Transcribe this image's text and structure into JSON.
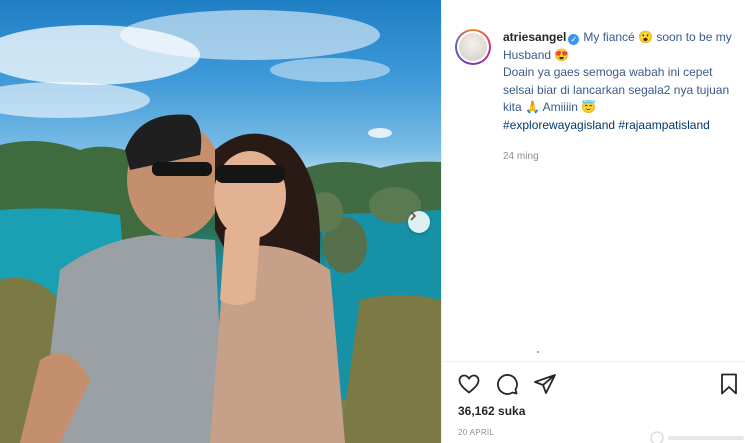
{
  "post": {
    "username": "atriesangel",
    "verified_icon": "verified-badge-icon",
    "caption_line1": "My fiancé 😮 soon to be my Husband 😍",
    "caption_line2": "Doain ya gaes semoga wabah ini cepet selsai biar di lancarkan segala2 nya tujuan kita 🙏 Amiiiin 😇",
    "hashtags": [
      "#explorewayagisland",
      "#rajaampatisland"
    ],
    "time_ago": "24 ming",
    "likes": "36,162 suka",
    "date": "20 APRIL"
  },
  "actions": {
    "like_icon": "heart-icon",
    "comment_icon": "comment-icon",
    "share_icon": "share-icon",
    "save_icon": "bookmark-icon"
  },
  "colors": {
    "link": "#00376b",
    "caption": "#3a5a8c",
    "muted": "#8e8e8e",
    "verified": "#3897f0"
  }
}
